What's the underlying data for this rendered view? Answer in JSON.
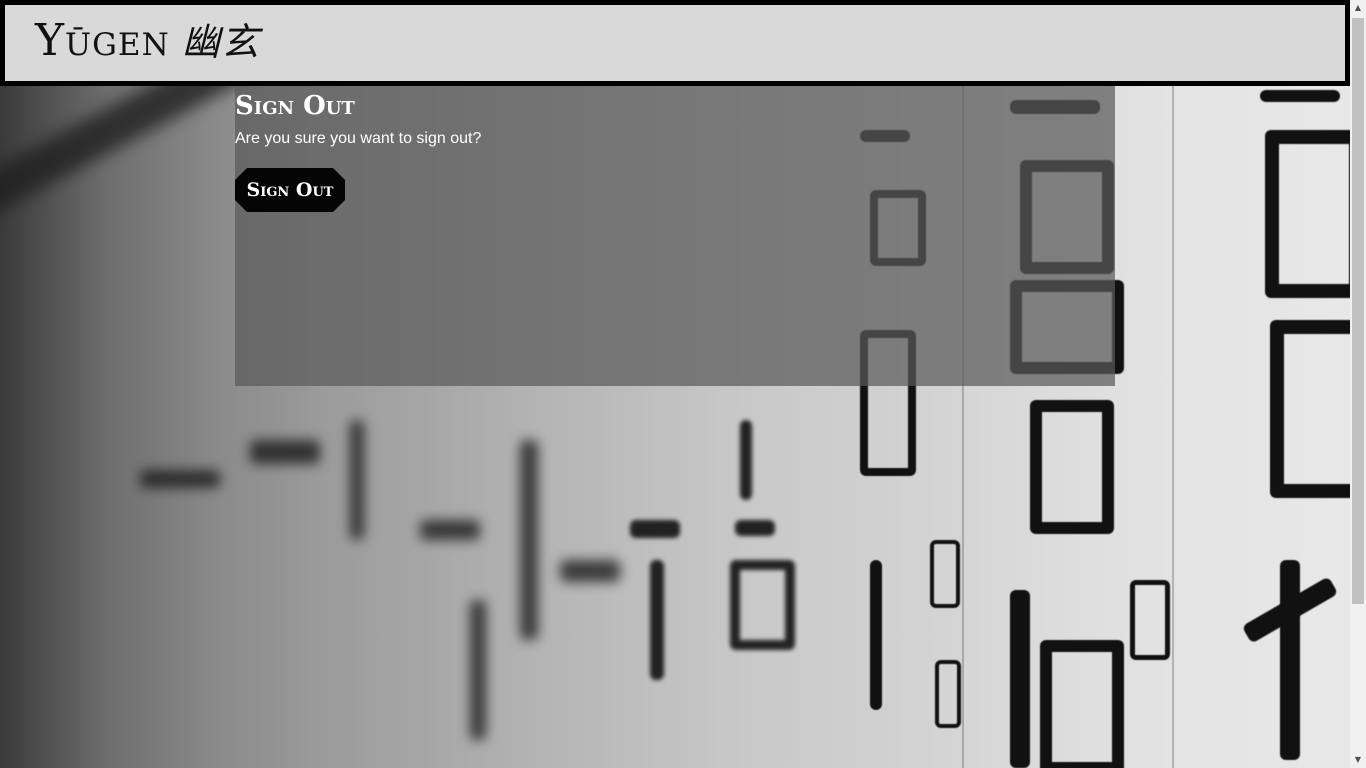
{
  "header": {
    "brand_latin": "Yūgen",
    "brand_kanji": "幽玄"
  },
  "signout": {
    "title": "Sign Out",
    "message": "Are you sure you want to sign out?",
    "button_label": "Sign Out"
  },
  "colors": {
    "header_bg": "#d9d9d9",
    "header_border": "#000000",
    "card_bg": "rgba(90,90,90,0.72)",
    "button_bg": "#050505",
    "text_light": "#ffffff"
  }
}
